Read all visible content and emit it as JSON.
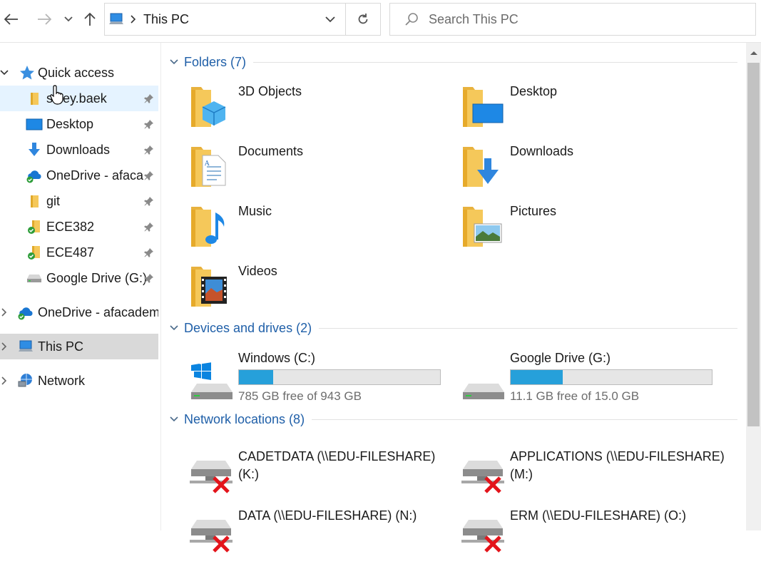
{
  "address": {
    "path": "This PC"
  },
  "search": {
    "placeholder": "Search This PC"
  },
  "sidebar": {
    "quick_access": "Quick access",
    "pinned": [
      {
        "label": "s​hley.baek",
        "icon": "folder-icon"
      },
      {
        "label": "Desktop",
        "icon": "desktop-icon"
      },
      {
        "label": "Downloads",
        "icon": "download-arrow-icon"
      },
      {
        "label": "OneDrive - afaca",
        "icon": "onedrive-icon"
      },
      {
        "label": "git",
        "icon": "folder-icon"
      },
      {
        "label": "ECE382",
        "icon": "folder-synced-icon"
      },
      {
        "label": "ECE487",
        "icon": "folder-synced-icon"
      },
      {
        "label": "Google Drive (G:)",
        "icon": "drive-icon"
      }
    ],
    "onedrive": "OneDrive - afacadem",
    "this_pc": "This PC",
    "network": "Network"
  },
  "main": {
    "folders_title": "Folders (7)",
    "folders": [
      {
        "label": "3D Objects",
        "icon": "3d-objects-folder-icon"
      },
      {
        "label": "Desktop",
        "icon": "desktop-folder-icon"
      },
      {
        "label": "Documents",
        "icon": "documents-folder-icon"
      },
      {
        "label": "Downloads",
        "icon": "downloads-folder-icon"
      },
      {
        "label": "Music",
        "icon": "music-folder-icon"
      },
      {
        "label": "Pictures",
        "icon": "pictures-folder-icon"
      },
      {
        "label": "Videos",
        "icon": "videos-folder-icon"
      }
    ],
    "devices_title": "Devices and drives (2)",
    "drives": [
      {
        "label": "Windows (C:)",
        "free": "785 GB free of 943 GB",
        "used_fraction": 0.17
      },
      {
        "label": "Google Drive (G:)",
        "free": "11.1 GB free of 15.0 GB",
        "used_fraction": 0.26
      }
    ],
    "network_title": "Network locations (8)",
    "network_locations": [
      {
        "line1": "CADETDATA (\\\\EDU-FILESHARE)",
        "line2": "(K:)"
      },
      {
        "line1": "APPLICATIONS (\\\\EDU-FILESHARE)",
        "line2": "(M:)"
      },
      {
        "line1": "DATA (\\\\EDU-FILESHARE) (N:)",
        "line2": ""
      },
      {
        "line1": "ERM (\\\\EDU-FILESHARE) (O:)",
        "line2": ""
      }
    ]
  },
  "colors": {
    "accent": "#1f5fa8",
    "drive_fill": "#26a0da",
    "folder": "#f5c85a",
    "selected": "#e5f3ff"
  }
}
